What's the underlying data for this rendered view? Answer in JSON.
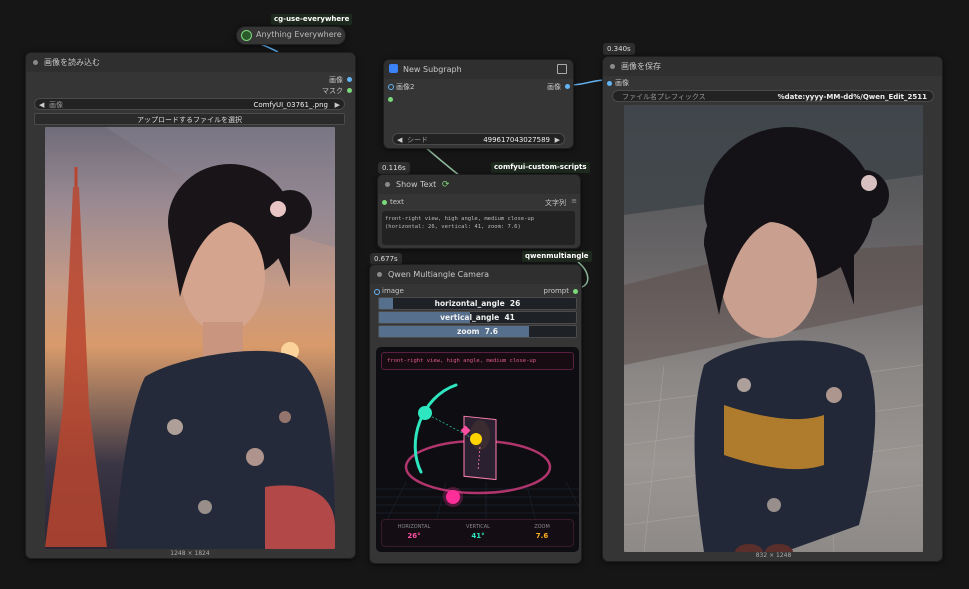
{
  "nodes": {
    "anything_everywhere": {
      "tag": "cg-use-everywhere",
      "title": "Anything Everywhere"
    },
    "load_image": {
      "title": "画像を読み込む",
      "out_image": "画像",
      "out_mask": "マスク",
      "image_label": "画像",
      "image_value": "ComfyUI_03761_.png",
      "upload_button": "アップロードするファイルを選択",
      "dims": "1248 × 1824"
    },
    "subgraph": {
      "title": "New Subgraph",
      "in_image2": "画像2",
      "out_image": "画像",
      "seed_label": "シード",
      "seed_value": "499617043027589"
    },
    "show_text": {
      "badge": "0.116s",
      "tag": "comfyui-custom-scripts",
      "title": "Show Text",
      "in_text": "text",
      "out_string": "文字列",
      "text_line1": "front-right view, high angle, medium close-up",
      "text_line2": "(horizontal: 26, vertical: 41, zoom: 7.6)"
    },
    "qwen_camera": {
      "badge": "0.677s",
      "tag": "qwenmultiangle",
      "title": "Qwen Multiangle Camera",
      "in_image": "image",
      "out_prompt": "prompt",
      "sliders": [
        {
          "label": "horizontal_angle",
          "value": "26",
          "fraction": 0.07
        },
        {
          "label": "vertical_angle",
          "value": "41",
          "fraction": 0.46
        },
        {
          "label": "zoom",
          "value": "7.6",
          "fraction": 0.76
        }
      ],
      "preview_prompt": "front-right view, high angle, medium close-up",
      "readouts": [
        {
          "label": "HORIZONTAL",
          "value": "26°",
          "color": "#ff4fa0"
        },
        {
          "label": "VERTICAL",
          "value": "41°",
          "color": "#2ee6c0"
        },
        {
          "label": "ZOOM",
          "value": "7.6",
          "color": "#ffb020"
        }
      ]
    },
    "save_image": {
      "badge": "0.340s",
      "title": "画像を保存",
      "in_image": "画像",
      "prefix_label": "ファイル名プレフィックス",
      "prefix_value": "%date:yyyy-MM-dd%/Qwen_Edit_2511",
      "dims": "832 × 1248"
    }
  },
  "colors": {
    "image_slot": "#64b5f6",
    "string_slot": "#7cd97c",
    "link_green": "#8fb99b",
    "link_blue": "#64b5f6"
  }
}
